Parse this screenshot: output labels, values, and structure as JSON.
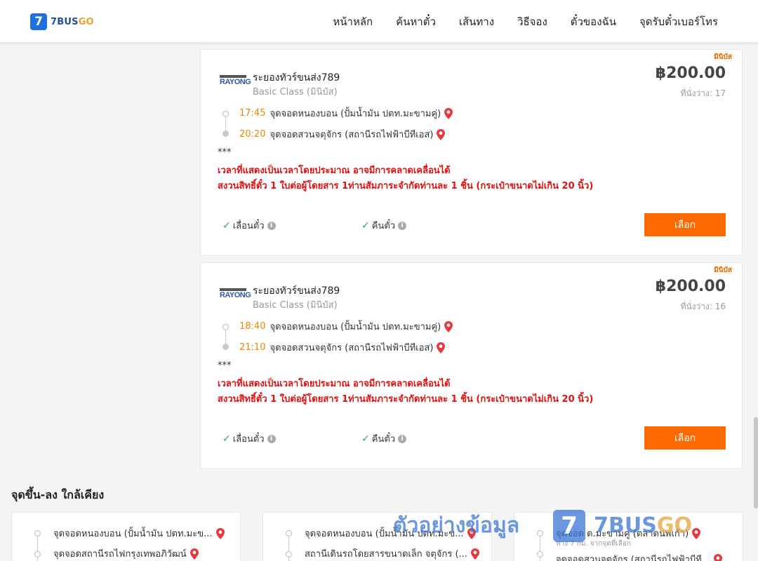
{
  "header": {
    "logo_number": "7",
    "logo_text_a": "7BUS",
    "logo_text_b": "GO",
    "nav": [
      "หน้าหลัก",
      "ค้นหาตั๋ว",
      "เส้นทาง",
      "วิธีจอง",
      "ตั๋วของฉัน",
      "จุดรับตั๋วเบอร์โทร"
    ]
  },
  "trips": [
    {
      "tag": "มินิบัส",
      "operator_logo": "RAYONG",
      "operator": "ระยองทัวร์ขนส่ง789",
      "class": "Basic Class (มินิบัส)",
      "price": "฿200.00",
      "seats": "ที่นั่งว่าง: 17",
      "depart_time": "17:45",
      "depart_stop": "จุดจอดหนองบอน (ปั้มน้ำมัน ปตท.มะขามคู่)",
      "arrive_time": "20:20",
      "arrive_stop": "จุดจอดสวนจตุจักร (สถานีรถไฟฟ้าบีทีเอส)",
      "stars": "***",
      "notice1": "เวลาที่แสดงเป็นเวลาโดยประมาณ อาจมีการคลาดเคลื่อนได้",
      "notice2": "สงวนสิทธิ์ตั๋ว 1 ใบต่อผู้โดยสาร 1ท่านสัมภาระจำกัดท่านละ 1 ชิ้น (กระเป๋าขนาดไม่เกิน 20 นิ้ว)",
      "opt_change": "เลื่อนตั๋ว",
      "opt_refund": "คืนตั๋ว",
      "button": "เลือก"
    },
    {
      "tag": "มินิบัส",
      "operator_logo": "RAYONG",
      "operator": "ระยองทัวร์ขนส่ง789",
      "class": "Basic Class (มินิบัส)",
      "price": "฿200.00",
      "seats": "ที่นั่งว่าง: 16",
      "depart_time": "18:40",
      "depart_stop": "จุดจอดหนองบอน (ปั้มน้ำมัน ปตท.มะขามคู่)",
      "arrive_time": "21:10",
      "arrive_stop": "จุดจอดสวนจตุจักร (สถานีรถไฟฟ้าบีทีเอส)",
      "stars": "***",
      "notice1": "เวลาที่แสดงเป็นเวลาโดยประมาณ อาจมีการคลาดเคลื่อนได้",
      "notice2": "สงวนสิทธิ์ตั๋ว 1 ใบต่อผู้โดยสาร 1ท่านสัมภาระจำกัดท่านละ 1 ชิ้น (กระเป๋าขนาดไม่เกิน 20 นิ้ว)",
      "opt_change": "เลื่อนตั๋ว",
      "opt_refund": "คืนตั๋ว",
      "button": "เลือก"
    }
  ],
  "nearby": {
    "title": "จุดขึ้น-ลง ใกล้เคียง",
    "cards": [
      {
        "stop_a": "จุดจอดหนองบอน (ปั้มน้ำมัน ปตท.มะข...",
        "stop_b": "จุดจอดสถานีรถไฟกรุงเทพอภิวัฒน์",
        "sub": ""
      },
      {
        "stop_a": "จุดจอดหนองบอน (ปั้มน้ำมัน ปตท.มะข...",
        "stop_b": "สถานีเดินรถโดยสารขนาดเล็ก จตุจักร (...",
        "sub": ""
      },
      {
        "stop_a": "จุดจอด ต.มะขามคู่ (ตลาดนพเก้า)",
        "stop_b": "จุดจอดสวนจตุจักร (สถานีรถไฟฟ้าบีที...",
        "sub": "ห่าง 7 กม. จากจุดที่เลือก"
      }
    ]
  },
  "watermark": {
    "text": "ตัวอย่างข้อมูล",
    "num": "7",
    "brand_a": "7BUS",
    "brand_b": "GO"
  },
  "colors": {
    "accent": "#ff6a00",
    "brand": "#1f6fe0",
    "notice": "#e01010",
    "time": "#e68a00",
    "tag": "#e36b00"
  },
  "icons": [
    "map-pin-icon",
    "check-icon",
    "info-icon"
  ]
}
